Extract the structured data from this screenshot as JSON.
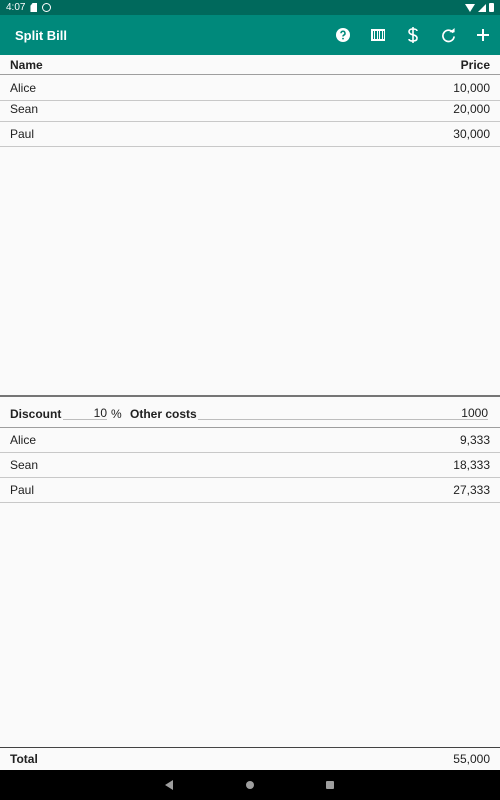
{
  "status_bar": {
    "time": "4:07"
  },
  "app_bar": {
    "title": "Split Bill",
    "actions": [
      {
        "icon": "help-icon"
      },
      {
        "icon": "barcode-icon"
      },
      {
        "icon": "dollar-icon"
      },
      {
        "icon": "refresh-icon"
      },
      {
        "icon": "add-icon"
      }
    ]
  },
  "items_table": {
    "header": {
      "name": "Name",
      "price": "Price"
    },
    "rows": [
      {
        "name": "Alice",
        "price": "10,000"
      },
      {
        "name": "Sean",
        "price": "20,000"
      },
      {
        "name": "Paul",
        "price": "30,000"
      }
    ]
  },
  "calc": {
    "discount_label": "Discount",
    "discount_value": "10",
    "percent_sign": "%",
    "other_costs_label": "Other costs",
    "other_costs_value": "1000"
  },
  "results": [
    {
      "name": "Alice",
      "amount": "9,333"
    },
    {
      "name": "Sean",
      "amount": "18,333"
    },
    {
      "name": "Paul",
      "amount": "27,333"
    }
  ],
  "total": {
    "label": "Total",
    "value": "55,000"
  },
  "colors": {
    "status_bar": "#00695c",
    "app_bar": "#00897b",
    "background": "#fafafa"
  }
}
